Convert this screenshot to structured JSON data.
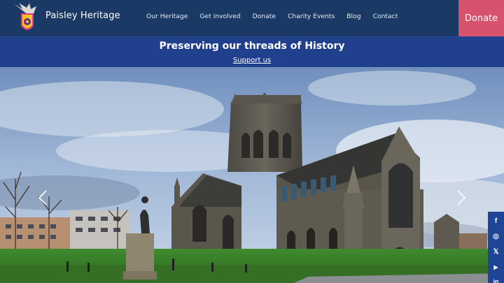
{
  "header": {
    "site_title": "Paisley Heritage",
    "nav": [
      {
        "label": "Our Heritage"
      },
      {
        "label": "Get involved"
      },
      {
        "label": "Donate"
      },
      {
        "label": "Charity Events"
      },
      {
        "label": "Blog"
      },
      {
        "label": "Contact"
      }
    ],
    "donate_label": "Donate"
  },
  "banner": {
    "heading": "Preserving our threads of History",
    "link": "Support us"
  },
  "hero": {
    "prev_icon": "chevron-left-icon",
    "next_icon": "chevron-right-icon"
  },
  "social": [
    {
      "icon": "facebook-icon",
      "glyph": "f"
    },
    {
      "icon": "instagram-icon",
      "glyph": "◎"
    },
    {
      "icon": "x-icon",
      "glyph": "𝕏"
    },
    {
      "icon": "youtube-icon",
      "glyph": "▶"
    },
    {
      "icon": "linkedin-icon",
      "glyph": "in"
    }
  ],
  "colors": {
    "header_bg": "#1b3965",
    "banner_bg": "#203f8d",
    "donate_bg": "#d7526d",
    "social_bg": "#1e4596"
  }
}
